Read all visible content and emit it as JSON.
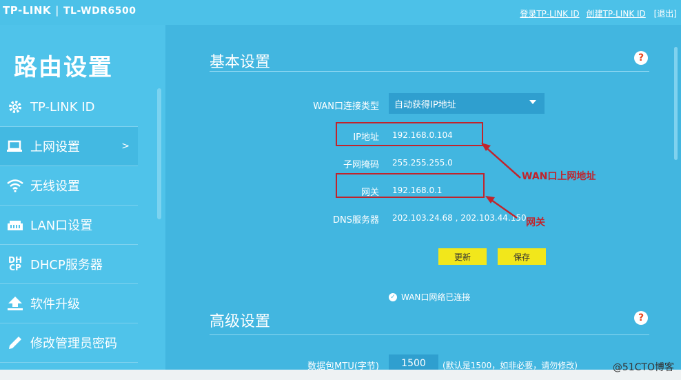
{
  "header": {
    "brand": "TP-LINK",
    "model": "TL-WDR6500",
    "login_link": "登录TP-LINK ID",
    "create_link": "创建TP-LINK ID",
    "logout": "[退出]"
  },
  "sidebar": {
    "title": "路由设置",
    "items": [
      {
        "label": "TP-LINK ID",
        "icon": "gear-icon"
      },
      {
        "label": "上网设置",
        "icon": "laptop-icon",
        "chevron": ">"
      },
      {
        "label": "无线设置",
        "icon": "wifi-icon"
      },
      {
        "label": "LAN口设置",
        "icon": "lan-port-icon"
      },
      {
        "label": "DHCP服务器",
        "icon": "dhcp-icon",
        "icon_text": "DH CP"
      },
      {
        "label": "软件升级",
        "icon": "upgrade-icon"
      },
      {
        "label": "修改管理员密码",
        "icon": "pencil-icon"
      }
    ]
  },
  "basic": {
    "title": "基本设置",
    "help": "?",
    "wan_type_label": "WAN口连接类型",
    "wan_type_value": "自动获得IP地址",
    "ip_label": "IP地址",
    "ip_value": "192.168.0.104",
    "mask_label": "子网掩码",
    "mask_value": "255.255.255.0",
    "gateway_label": "网关",
    "gateway_value": "192.168.0.1",
    "dns_label": "DNS服务器",
    "dns_value": "202.103.24.68 , 202.103.44.150",
    "refresh_button": "更新",
    "save_button": "保存",
    "status": "WAN口网络已连接"
  },
  "advanced": {
    "title": "高级设置",
    "help": "?",
    "mtu_label": "数据包MTU(字节)",
    "mtu_value": "1500",
    "mtu_hint": "(默认是1500，如非必要，请勿修改)"
  },
  "annotations": {
    "wan_ip": "WAN口上网地址",
    "gateway": "网关"
  },
  "watermark": "@51CTO博客",
  "colors": {
    "background": "#4cc1e8",
    "main_panel": "#42b6e0",
    "button": "#f2e71b",
    "annotation": "#c0242c"
  }
}
